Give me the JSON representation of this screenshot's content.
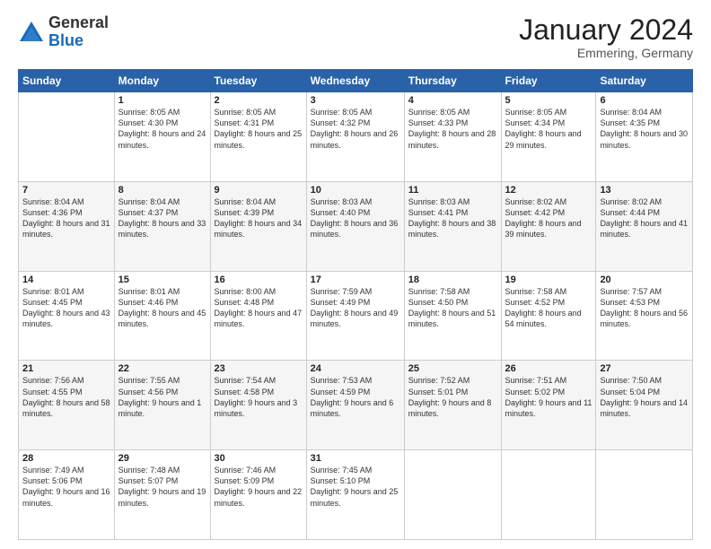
{
  "header": {
    "logo_line1": "General",
    "logo_line2": "Blue",
    "month_year": "January 2024",
    "location": "Emmering, Germany"
  },
  "days_of_week": [
    "Sunday",
    "Monday",
    "Tuesday",
    "Wednesday",
    "Thursday",
    "Friday",
    "Saturday"
  ],
  "weeks": [
    [
      {
        "day": "",
        "sunrise": "",
        "sunset": "",
        "daylight": ""
      },
      {
        "day": "1",
        "sunrise": "Sunrise: 8:05 AM",
        "sunset": "Sunset: 4:30 PM",
        "daylight": "Daylight: 8 hours and 24 minutes."
      },
      {
        "day": "2",
        "sunrise": "Sunrise: 8:05 AM",
        "sunset": "Sunset: 4:31 PM",
        "daylight": "Daylight: 8 hours and 25 minutes."
      },
      {
        "day": "3",
        "sunrise": "Sunrise: 8:05 AM",
        "sunset": "Sunset: 4:32 PM",
        "daylight": "Daylight: 8 hours and 26 minutes."
      },
      {
        "day": "4",
        "sunrise": "Sunrise: 8:05 AM",
        "sunset": "Sunset: 4:33 PM",
        "daylight": "Daylight: 8 hours and 28 minutes."
      },
      {
        "day": "5",
        "sunrise": "Sunrise: 8:05 AM",
        "sunset": "Sunset: 4:34 PM",
        "daylight": "Daylight: 8 hours and 29 minutes."
      },
      {
        "day": "6",
        "sunrise": "Sunrise: 8:04 AM",
        "sunset": "Sunset: 4:35 PM",
        "daylight": "Daylight: 8 hours and 30 minutes."
      }
    ],
    [
      {
        "day": "7",
        "sunrise": "Sunrise: 8:04 AM",
        "sunset": "Sunset: 4:36 PM",
        "daylight": "Daylight: 8 hours and 31 minutes."
      },
      {
        "day": "8",
        "sunrise": "Sunrise: 8:04 AM",
        "sunset": "Sunset: 4:37 PM",
        "daylight": "Daylight: 8 hours and 33 minutes."
      },
      {
        "day": "9",
        "sunrise": "Sunrise: 8:04 AM",
        "sunset": "Sunset: 4:39 PM",
        "daylight": "Daylight: 8 hours and 34 minutes."
      },
      {
        "day": "10",
        "sunrise": "Sunrise: 8:03 AM",
        "sunset": "Sunset: 4:40 PM",
        "daylight": "Daylight: 8 hours and 36 minutes."
      },
      {
        "day": "11",
        "sunrise": "Sunrise: 8:03 AM",
        "sunset": "Sunset: 4:41 PM",
        "daylight": "Daylight: 8 hours and 38 minutes."
      },
      {
        "day": "12",
        "sunrise": "Sunrise: 8:02 AM",
        "sunset": "Sunset: 4:42 PM",
        "daylight": "Daylight: 8 hours and 39 minutes."
      },
      {
        "day": "13",
        "sunrise": "Sunrise: 8:02 AM",
        "sunset": "Sunset: 4:44 PM",
        "daylight": "Daylight: 8 hours and 41 minutes."
      }
    ],
    [
      {
        "day": "14",
        "sunrise": "Sunrise: 8:01 AM",
        "sunset": "Sunset: 4:45 PM",
        "daylight": "Daylight: 8 hours and 43 minutes."
      },
      {
        "day": "15",
        "sunrise": "Sunrise: 8:01 AM",
        "sunset": "Sunset: 4:46 PM",
        "daylight": "Daylight: 8 hours and 45 minutes."
      },
      {
        "day": "16",
        "sunrise": "Sunrise: 8:00 AM",
        "sunset": "Sunset: 4:48 PM",
        "daylight": "Daylight: 8 hours and 47 minutes."
      },
      {
        "day": "17",
        "sunrise": "Sunrise: 7:59 AM",
        "sunset": "Sunset: 4:49 PM",
        "daylight": "Daylight: 8 hours and 49 minutes."
      },
      {
        "day": "18",
        "sunrise": "Sunrise: 7:58 AM",
        "sunset": "Sunset: 4:50 PM",
        "daylight": "Daylight: 8 hours and 51 minutes."
      },
      {
        "day": "19",
        "sunrise": "Sunrise: 7:58 AM",
        "sunset": "Sunset: 4:52 PM",
        "daylight": "Daylight: 8 hours and 54 minutes."
      },
      {
        "day": "20",
        "sunrise": "Sunrise: 7:57 AM",
        "sunset": "Sunset: 4:53 PM",
        "daylight": "Daylight: 8 hours and 56 minutes."
      }
    ],
    [
      {
        "day": "21",
        "sunrise": "Sunrise: 7:56 AM",
        "sunset": "Sunset: 4:55 PM",
        "daylight": "Daylight: 8 hours and 58 minutes."
      },
      {
        "day": "22",
        "sunrise": "Sunrise: 7:55 AM",
        "sunset": "Sunset: 4:56 PM",
        "daylight": "Daylight: 9 hours and 1 minute."
      },
      {
        "day": "23",
        "sunrise": "Sunrise: 7:54 AM",
        "sunset": "Sunset: 4:58 PM",
        "daylight": "Daylight: 9 hours and 3 minutes."
      },
      {
        "day": "24",
        "sunrise": "Sunrise: 7:53 AM",
        "sunset": "Sunset: 4:59 PM",
        "daylight": "Daylight: 9 hours and 6 minutes."
      },
      {
        "day": "25",
        "sunrise": "Sunrise: 7:52 AM",
        "sunset": "Sunset: 5:01 PM",
        "daylight": "Daylight: 9 hours and 8 minutes."
      },
      {
        "day": "26",
        "sunrise": "Sunrise: 7:51 AM",
        "sunset": "Sunset: 5:02 PM",
        "daylight": "Daylight: 9 hours and 11 minutes."
      },
      {
        "day": "27",
        "sunrise": "Sunrise: 7:50 AM",
        "sunset": "Sunset: 5:04 PM",
        "daylight": "Daylight: 9 hours and 14 minutes."
      }
    ],
    [
      {
        "day": "28",
        "sunrise": "Sunrise: 7:49 AM",
        "sunset": "Sunset: 5:06 PM",
        "daylight": "Daylight: 9 hours and 16 minutes."
      },
      {
        "day": "29",
        "sunrise": "Sunrise: 7:48 AM",
        "sunset": "Sunset: 5:07 PM",
        "daylight": "Daylight: 9 hours and 19 minutes."
      },
      {
        "day": "30",
        "sunrise": "Sunrise: 7:46 AM",
        "sunset": "Sunset: 5:09 PM",
        "daylight": "Daylight: 9 hours and 22 minutes."
      },
      {
        "day": "31",
        "sunrise": "Sunrise: 7:45 AM",
        "sunset": "Sunset: 5:10 PM",
        "daylight": "Daylight: 9 hours and 25 minutes."
      },
      {
        "day": "",
        "sunrise": "",
        "sunset": "",
        "daylight": ""
      },
      {
        "day": "",
        "sunrise": "",
        "sunset": "",
        "daylight": ""
      },
      {
        "day": "",
        "sunrise": "",
        "sunset": "",
        "daylight": ""
      }
    ]
  ]
}
